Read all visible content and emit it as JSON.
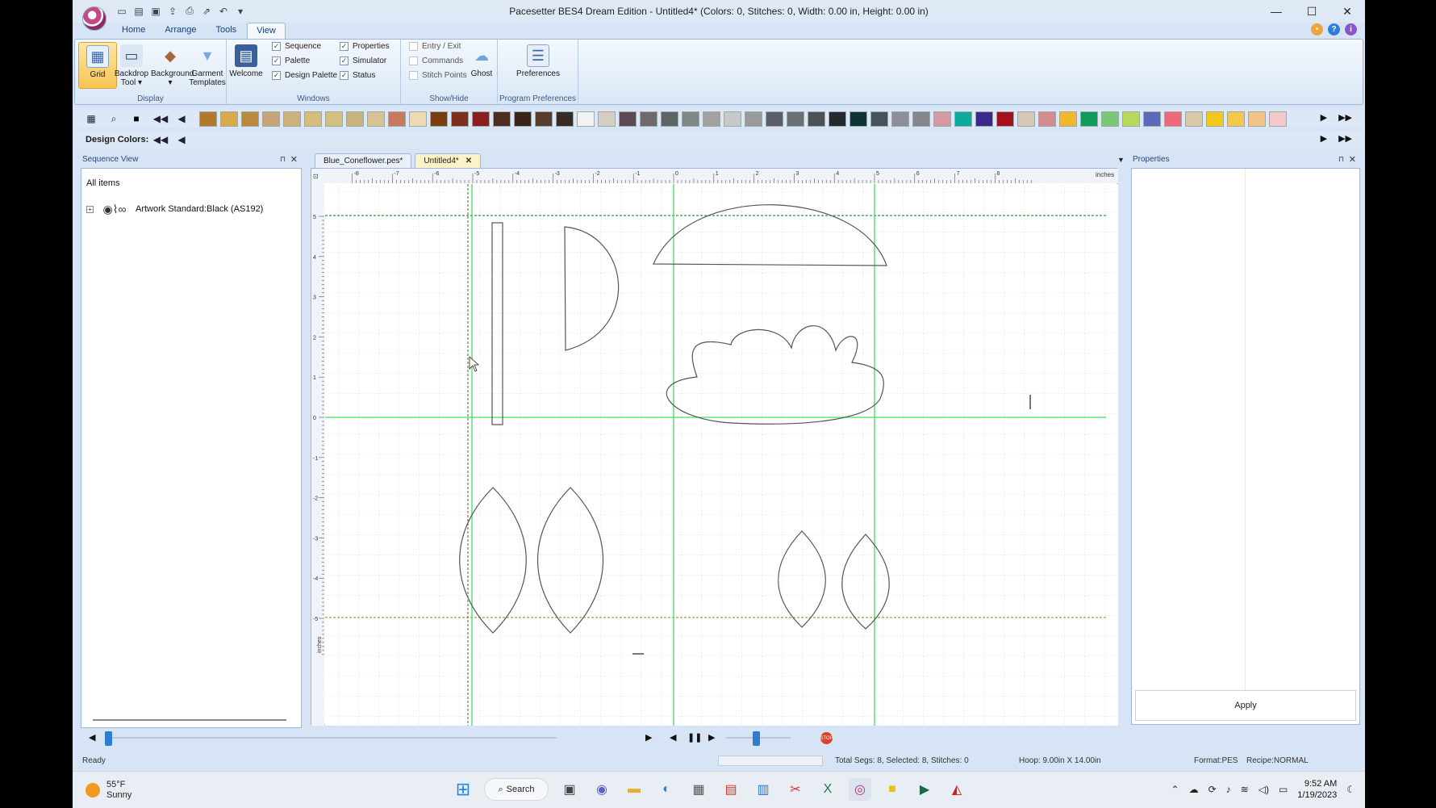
{
  "window": {
    "title": "Pacesetter BES4 Dream Edition - Untitled4* (Colors: 0, Stitches: 0, Width: 0.00 in, Height: 0.00 in)",
    "controls": [
      "—",
      "☐",
      "✕"
    ]
  },
  "ribbon_tabs": [
    {
      "label": "Home"
    },
    {
      "label": "Arrange"
    },
    {
      "label": "Tools"
    },
    {
      "label": "View",
      "active": true
    }
  ],
  "ribbon": {
    "display": {
      "label": "Display",
      "buttons": [
        {
          "label": "Grid",
          "active": true
        },
        {
          "label": "Backdrop Tool ▾"
        },
        {
          "label": "Background ▾"
        },
        {
          "label": "Garment Templates"
        }
      ]
    },
    "windows": {
      "label": "Windows",
      "welcome": "Welcome",
      "checks_col1": [
        {
          "label": "Sequence",
          "checked": true
        },
        {
          "label": "Palette",
          "checked": true
        },
        {
          "label": "Design Palette",
          "checked": true
        }
      ],
      "checks_col2": [
        {
          "label": "Properties",
          "checked": true
        },
        {
          "label": "Simulator",
          "checked": true
        },
        {
          "label": "Status",
          "checked": true
        }
      ]
    },
    "showhide": {
      "label": "Show/Hide",
      "checks": [
        {
          "label": "Entry / Exit",
          "checked": false
        },
        {
          "label": "Commands",
          "checked": false
        },
        {
          "label": "Stitch Points",
          "checked": false
        }
      ],
      "ghost": "Ghost"
    },
    "prefs": {
      "label": "Program Preferences",
      "button": "Preferences"
    }
  },
  "palette": {
    "colors": [
      "#b07a2a",
      "#d9a94a",
      "#b8893e",
      "#c7a27a",
      "#cdb07a",
      "#d6bd79",
      "#d4c07e",
      "#c8b27e",
      "#d7c494",
      "#c77a5e",
      "#efd9b4",
      "#7a3d12",
      "#7b2f1c",
      "#8b1e1e",
      "#4e2c20",
      "#3b2318",
      "#5a3c2e",
      "#3a2a26",
      "#f2f2f2",
      "#d4cfc2",
      "#5e4a55",
      "#6e6a6a",
      "#5e6464",
      "#7e8686",
      "#a4a0a0",
      "#c8c8c8",
      "#9a9a9a",
      "#5a6066",
      "#6a7074",
      "#4e5256",
      "#242a2e",
      "#0e3438",
      "#46545a",
      "#8e8e9a",
      "#86868e",
      "#d49aa2",
      "#10aa9a",
      "#3b2a8a",
      "#a4101e",
      "#d6c6b6",
      "#d48a8e",
      "#f0b82a",
      "#109a5a",
      "#78c878",
      "#b8d85a",
      "#5a6ab8",
      "#ee6a7a",
      "#d8c8a8",
      "#f2c81a",
      "#f4c84a",
      "#f2c48a",
      "#f4c8c8"
    ],
    "design_colors_label": "Design Colors:"
  },
  "sequence_view": {
    "title": "Sequence View",
    "root": "All items",
    "item_label": "Artwork Standard:Black (AS192)"
  },
  "doc_tabs": [
    {
      "label": "Blue_Coneflower.pes*",
      "active": false
    },
    {
      "label": "Untitled4*",
      "active": true
    }
  ],
  "ruler": {
    "units": "inches",
    "x_ticks": [
      "-8",
      "-7",
      "-6",
      "-5",
      "-4",
      "-3",
      "-2",
      "-1",
      "0",
      "1",
      "2",
      "3",
      "4",
      "5",
      "6",
      "7",
      "8"
    ],
    "y_ticks": [
      "5",
      "4",
      "3",
      "2",
      "1",
      "0",
      "-1",
      "-2",
      "-3",
      "-4",
      "-5"
    ],
    "y_units": "inches"
  },
  "properties": {
    "title": "Properties",
    "apply": "Apply"
  },
  "status": {
    "ready": "Ready",
    "segments": "Total Segs: 8, Selected: 8, Stitches: 0",
    "hoop": "Hoop: 9.00in X 14.00in",
    "format": "Format:PES",
    "recipe": "Recipe:NORMAL"
  },
  "taskbar": {
    "temp": "55°F",
    "condition": "Sunny",
    "search": "Search",
    "time": "9:52 AM",
    "date": "1/19/2023"
  }
}
